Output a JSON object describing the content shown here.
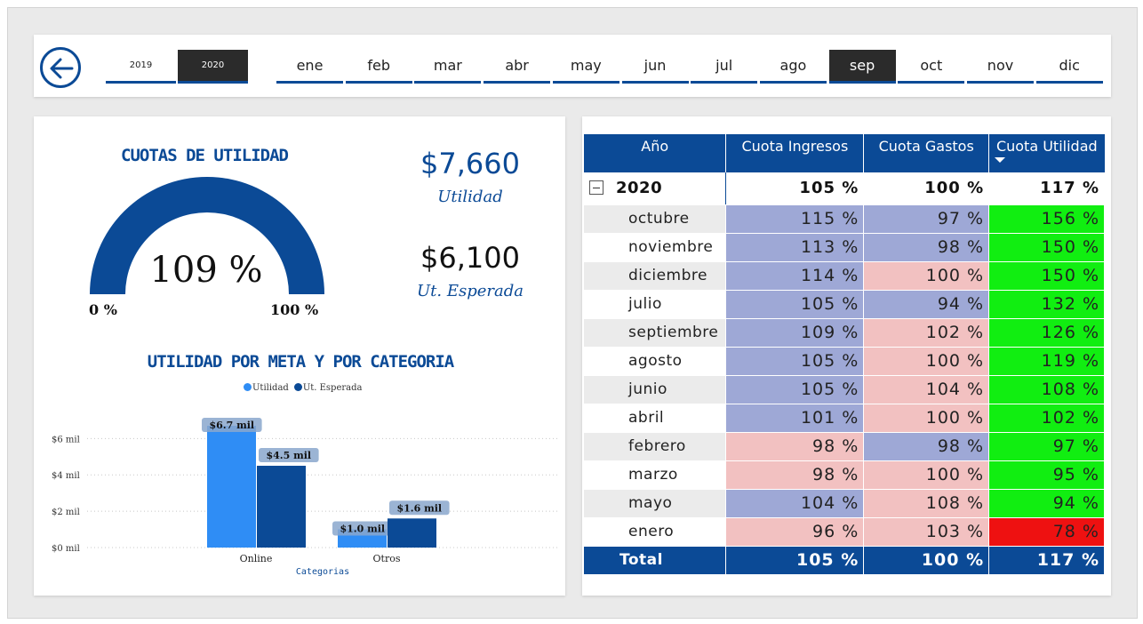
{
  "colors": {
    "brand": "#0b4a96",
    "utilidad_bar": "#2f8df5",
    "esperada_bar": "#0b4a96",
    "cell_blue": "#9ea8d6",
    "cell_pink": "#f2c1c1",
    "cell_green": "#11ee11",
    "cell_red": "#ee1111",
    "row_alt": "#ebebeb"
  },
  "nav": {
    "back_icon": "arrow-left-circle-icon",
    "years": [
      "2019",
      "2020"
    ],
    "selected_year": "2020",
    "months": [
      "ene",
      "feb",
      "mar",
      "abr",
      "may",
      "jun",
      "jul",
      "ago",
      "sep",
      "oct",
      "nov",
      "dic"
    ],
    "selected_month": "sep"
  },
  "gauge": {
    "title": "CUOTAS DE UTILIDAD",
    "value_label": "109 %",
    "value_fraction": 1.0,
    "min_label": "0 %",
    "max_label": "100 %"
  },
  "kpis": {
    "utilidad_value": "$7,660",
    "utilidad_label": "Utilidad",
    "esperada_value": "$6,100",
    "esperada_label": "Ut. Esperada"
  },
  "chart": {
    "title": "UTILIDAD POR META Y POR CATEGORIA",
    "x_title": "Categorias"
  },
  "chart_data": {
    "type": "bar",
    "title": "UTILIDAD POR META Y POR CATEGORIA",
    "xlabel": "Categorias",
    "ylabel": "",
    "categories": [
      "Online",
      "Otros"
    ],
    "series": [
      {
        "name": "Utilidad",
        "values": [
          6.7,
          1.0
        ],
        "labels": [
          "$6.7 mil",
          "$1.0 mil"
        ]
      },
      {
        "name": "Ut. Esperada",
        "values": [
          4.5,
          1.6
        ],
        "labels": [
          "$4.5 mil",
          "$1.6 mil"
        ]
      }
    ],
    "ylim": [
      0,
      6.7
    ],
    "yticks": [
      0,
      2,
      4,
      6
    ],
    "ytick_labels": [
      "$0 mil",
      "$2 mil",
      "$4 mil",
      "$6 mil"
    ],
    "legend_position": "top-center",
    "grid": true
  },
  "matrix": {
    "headers": [
      "Año",
      "Cuota Ingresos",
      "Cuota Gastos",
      "Cuota Utilidad"
    ],
    "sorted_column_icon": "sort-descending-icon",
    "year_row": {
      "label": "2020",
      "ingresos": "105 %",
      "gastos": "100 %",
      "utilidad": "117 %"
    },
    "rows": [
      {
        "mes": "octubre",
        "ingresos": "115 %",
        "gastos": "97 %",
        "utilidad": "156 %",
        "ci": "blue",
        "cg": "blue",
        "cu": "green"
      },
      {
        "mes": "noviembre",
        "ingresos": "113 %",
        "gastos": "98 %",
        "utilidad": "150 %",
        "ci": "blue",
        "cg": "blue",
        "cu": "green"
      },
      {
        "mes": "diciembre",
        "ingresos": "114 %",
        "gastos": "100 %",
        "utilidad": "150 %",
        "ci": "blue",
        "cg": "pink",
        "cu": "green"
      },
      {
        "mes": "julio",
        "ingresos": "105 %",
        "gastos": "94 %",
        "utilidad": "132 %",
        "ci": "blue",
        "cg": "blue",
        "cu": "green"
      },
      {
        "mes": "septiembre",
        "ingresos": "109 %",
        "gastos": "102 %",
        "utilidad": "126 %",
        "ci": "blue",
        "cg": "pink",
        "cu": "green"
      },
      {
        "mes": "agosto",
        "ingresos": "105 %",
        "gastos": "100 %",
        "utilidad": "119 %",
        "ci": "blue",
        "cg": "pink",
        "cu": "green"
      },
      {
        "mes": "junio",
        "ingresos": "105 %",
        "gastos": "104 %",
        "utilidad": "108 %",
        "ci": "blue",
        "cg": "pink",
        "cu": "green"
      },
      {
        "mes": "abril",
        "ingresos": "101 %",
        "gastos": "100 %",
        "utilidad": "102 %",
        "ci": "blue",
        "cg": "pink",
        "cu": "green"
      },
      {
        "mes": "febrero",
        "ingresos": "98 %",
        "gastos": "98 %",
        "utilidad": "97 %",
        "ci": "pink",
        "cg": "blue",
        "cu": "green"
      },
      {
        "mes": "marzo",
        "ingresos": "98 %",
        "gastos": "100 %",
        "utilidad": "95 %",
        "ci": "pink",
        "cg": "pink",
        "cu": "green"
      },
      {
        "mes": "mayo",
        "ingresos": "104 %",
        "gastos": "108 %",
        "utilidad": "94 %",
        "ci": "blue",
        "cg": "pink",
        "cu": "green"
      },
      {
        "mes": "enero",
        "ingresos": "96 %",
        "gastos": "103 %",
        "utilidad": "78 %",
        "ci": "pink",
        "cg": "pink",
        "cu": "red"
      }
    ],
    "total_row": {
      "label": "Total",
      "ingresos": "105 %",
      "gastos": "100 %",
      "utilidad": "117 %"
    }
  }
}
